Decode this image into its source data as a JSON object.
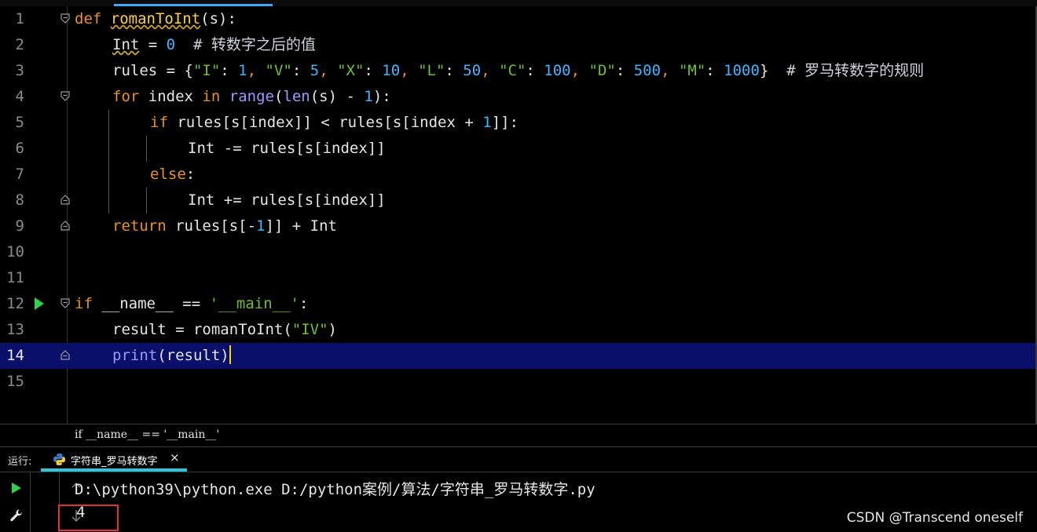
{
  "editor": {
    "lines": [
      {
        "n": "1"
      },
      {
        "n": "2"
      },
      {
        "n": "3"
      },
      {
        "n": "4"
      },
      {
        "n": "5"
      },
      {
        "n": "6"
      },
      {
        "n": "7"
      },
      {
        "n": "8"
      },
      {
        "n": "9"
      },
      {
        "n": "10"
      },
      {
        "n": "11"
      },
      {
        "n": "12"
      },
      {
        "n": "13"
      },
      {
        "n": "14"
      },
      {
        "n": "15"
      }
    ],
    "current_line": "14",
    "code": {
      "l1_kw": "def ",
      "l1_fn": "romanToInt",
      "l1_rest": "(s):",
      "l2_var": "Int",
      "l2_eq": " = ",
      "l2_num": "0",
      "l2_cm": "  # 转数字之后的值",
      "l3_a": "rules = {",
      "l3_k1": "\"I\"",
      "l3_v1": "1",
      "l3_k2": "\"V\"",
      "l3_v2": "5",
      "l3_k3": "\"X\"",
      "l3_v3": "10",
      "l3_k4": "\"L\"",
      "l3_v4": "50",
      "l3_k5": "\"C\"",
      "l3_v5": "100",
      "l3_k6": "\"D\"",
      "l3_v6": "500",
      "l3_k7": "\"M\"",
      "l3_v7": "1000",
      "l3_cm": "  # 罗马转数字的规则",
      "l4_kw1": "for",
      "l4_a": " index ",
      "l4_kw2": "in",
      "l4_bi1": "range",
      "l4_b": "(",
      "l4_bi2": "len",
      "l4_c": "(s) - ",
      "l4_num": "1",
      "l4_d": "):",
      "l5_kw": "if",
      "l5_a": " rules[s[index]] < rules[s[index + ",
      "l5_num": "1",
      "l5_b": "]]:",
      "l6": "Int -= rules[s[index]]",
      "l7_kw": "else",
      "l7_b": ":",
      "l8": "Int += rules[s[index]]",
      "l9_kw": "return",
      "l9_a": " rules[s[-",
      "l9_num": "1",
      "l9_b": "]] + Int",
      "l12_kw": "if",
      "l12_a": " __name__ == ",
      "l12_str": "'__main__'",
      "l12_b": ":",
      "l13_a": "result = romanToInt(",
      "l13_str": "\"IV\"",
      "l13_b": ")",
      "l14_bi": "print",
      "l14_a": "(result)"
    }
  },
  "breadcrumb": "if __name__ == '__main__'",
  "run_panel": {
    "label": "运行:",
    "tab_label": "字符串_罗马转数字",
    "close": "×",
    "command": "D:\\python39\\python.exe D:/python案例/算法/字符串_罗马转数字.py",
    "result": "4"
  },
  "watermark": "CSDN @Transcend oneself",
  "colors": {
    "current_line_bg": "#0a0f6a",
    "keyword": "#e8912d",
    "number": "#41b4ff",
    "string": "#6fbf3c",
    "run_green": "#2fd34a",
    "tab_underline": "#28c8d8",
    "highlight_box": "#e03434"
  }
}
